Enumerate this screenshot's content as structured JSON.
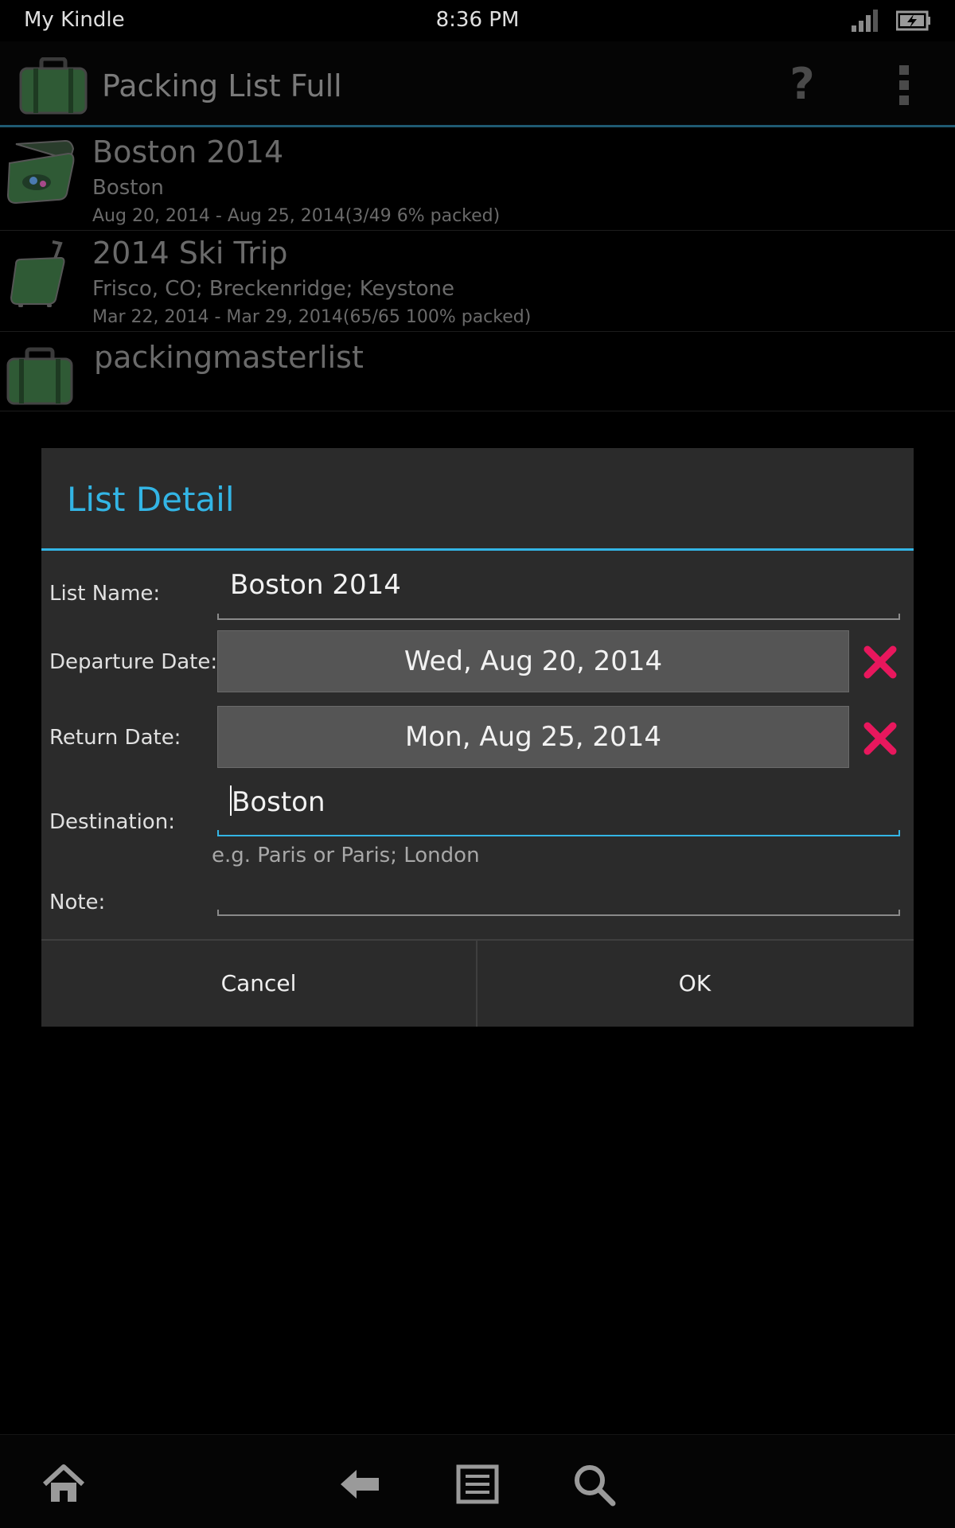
{
  "status_bar": {
    "carrier": "My Kindle",
    "time": "8:36 PM"
  },
  "action_bar": {
    "title": "Packing List Full",
    "help_label": "?"
  },
  "lists": [
    {
      "name": "Boston 2014",
      "destination": "Boston",
      "dates": "Aug 20, 2014 - Aug 25, 2014(3/49 6% packed)"
    },
    {
      "name": "2014 Ski Trip",
      "destination": "Frisco, CO; Breckenridge; Keystone",
      "dates": "Mar 22, 2014 - Mar 29, 2014(65/65 100% packed)"
    },
    {
      "name": "packingmasterlist",
      "destination": "",
      "dates": ""
    }
  ],
  "dialog": {
    "title": "List Detail",
    "list_name_label": "List Name:",
    "list_name_value": "Boston 2014",
    "departure_label": "Departure Date:",
    "departure_value": "Wed, Aug 20, 2014",
    "return_label": "Return Date:",
    "return_value": "Mon, Aug 25, 2014",
    "destination_label": "Destination:",
    "destination_value": "Boston",
    "destination_hint": "e.g. Paris or Paris; London",
    "note_label": "Note:",
    "note_value": "",
    "cancel_label": "Cancel",
    "ok_label": "OK"
  },
  "colors": {
    "accent": "#33b5e5",
    "clear_x": "#e8175d",
    "bag_green": "#2f5a35"
  }
}
